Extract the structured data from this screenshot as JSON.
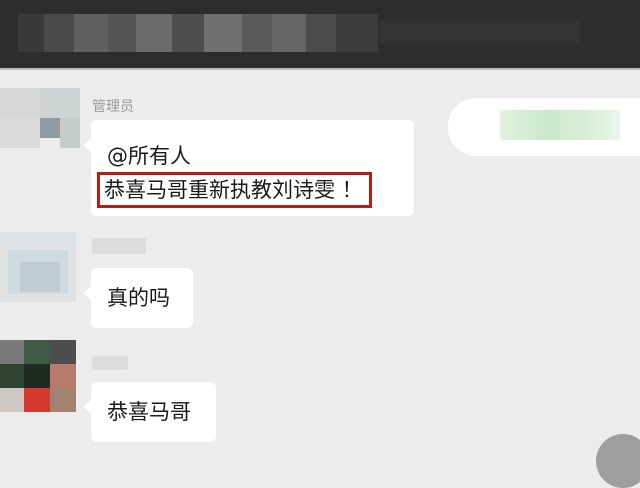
{
  "chat": {
    "group_role_label": "管理员",
    "messages": [
      {
        "sender": "管理员",
        "mention": "@所有人",
        "text": "恭喜马哥重新执教刘诗雯 ！"
      },
      {
        "sender": "",
        "text": "真的吗"
      },
      {
        "sender": "",
        "text": "恭喜马哥"
      }
    ]
  },
  "colors": {
    "topbar_bg": "#2d2d2d",
    "chat_bg": "#ececec",
    "bubble_bg": "#ffffff",
    "highlight_border": "#b3201c"
  }
}
